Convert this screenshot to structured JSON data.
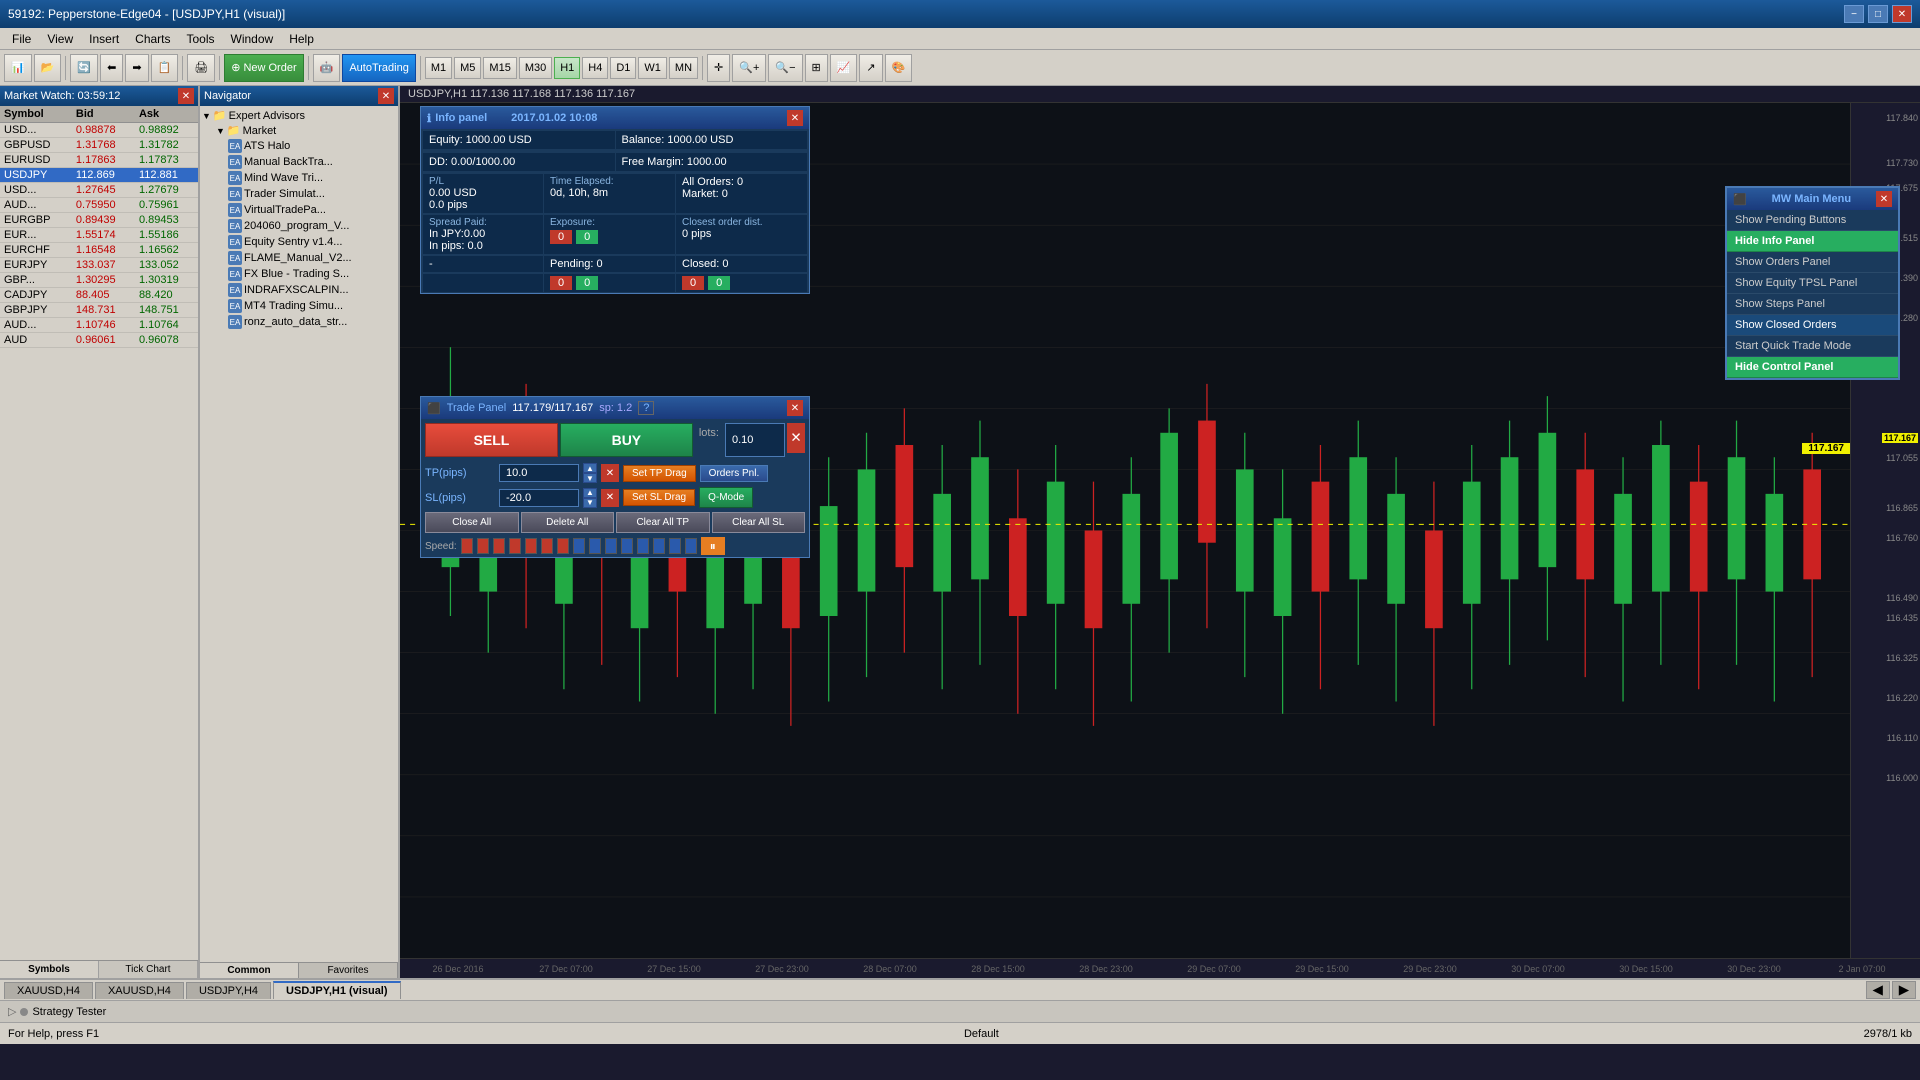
{
  "titleBar": {
    "title": "59192: Pepperstone-Edge04 - [USDJPY,H1 (visual)]",
    "minimizeLabel": "−",
    "maximizeLabel": "□",
    "closeLabel": "✕"
  },
  "menuBar": {
    "items": [
      "File",
      "View",
      "Insert",
      "Charts",
      "Tools",
      "Window",
      "Help"
    ]
  },
  "toolbar": {
    "newOrderLabel": "New Order",
    "autoTradingLabel": "AutoTrading",
    "periods": [
      "M1",
      "M5",
      "M15",
      "M30",
      "H1",
      "H4",
      "D1",
      "W1",
      "MN"
    ]
  },
  "chartHeader": {
    "title": "USDJPY,H1  117.136 117.168 117.136 117.167"
  },
  "marketWatch": {
    "header": "Market Watch: 03:59:12",
    "columns": [
      "Symbol",
      "Bid",
      "Ask"
    ],
    "rows": [
      {
        "symbol": "USD...",
        "bid": "0.98878",
        "ask": "0.98892",
        "selected": false
      },
      {
        "symbol": "GBPUSD",
        "bid": "1.31768",
        "ask": "1.31782",
        "selected": false
      },
      {
        "symbol": "EURUSD",
        "bid": "1.17863",
        "ask": "1.17873",
        "selected": false
      },
      {
        "symbol": "USDJPY",
        "bid": "112.869",
        "ask": "112.881",
        "selected": true
      },
      {
        "symbol": "USD...",
        "bid": "1.27645",
        "ask": "1.27679",
        "selected": false
      },
      {
        "symbol": "AUD...",
        "bid": "0.75950",
        "ask": "0.75961",
        "selected": false
      },
      {
        "symbol": "EURGBP",
        "bid": "0.89439",
        "ask": "0.89453",
        "selected": false
      },
      {
        "symbol": "EUR...",
        "bid": "1.55174",
        "ask": "1.55186",
        "selected": false
      },
      {
        "symbol": "EURCHF",
        "bid": "1.16548",
        "ask": "1.16562",
        "selected": false
      },
      {
        "symbol": "EURJPY",
        "bid": "133.037",
        "ask": "133.052",
        "selected": false
      },
      {
        "symbol": "GBP...",
        "bid": "1.30295",
        "ask": "1.30319",
        "selected": false
      },
      {
        "symbol": "CADJPY",
        "bid": "88.405",
        "ask": "88.420",
        "selected": false
      },
      {
        "symbol": "GBPJPY",
        "bid": "148.731",
        "ask": "148.751",
        "selected": false
      },
      {
        "symbol": "AUD...",
        "bid": "1.10746",
        "ask": "1.10764",
        "selected": false
      },
      {
        "symbol": "AUD",
        "bid": "0.96061",
        "ask": "0.96078",
        "selected": false
      }
    ],
    "tabs": [
      "Symbols",
      "Tick Chart"
    ]
  },
  "navigator": {
    "header": "Navigator",
    "expertAdvisors": {
      "label": "Expert Advisors",
      "market": {
        "label": "Market",
        "items": [
          "ATS Halo",
          "Manual BackTra...",
          "Mind Wave Tri...",
          "Trader Simulat...",
          "VirtualTradePa...",
          "204060_program_V...",
          "Equity Sentry v1.4...",
          "FLAME_Manual_V2...",
          "FX Blue - Trading S...",
          "INDRAFXSCALPIN...",
          "MT4 Trading Simu...",
          "ronz_auto_data_str..."
        ]
      }
    },
    "tabs": [
      "Common",
      "Favorites"
    ]
  },
  "infoPanel": {
    "title": "Info panel",
    "timestamp": "2017.01.02 10:08",
    "equity": "Equity: 1000.00 USD",
    "balance": "Balance: 1000.00 USD",
    "dd": "DD: 0.00/1000.00",
    "freeMargin": "Free Margin: 1000.00",
    "pl": "P/L",
    "timeElapsed": "Time Elapsed:",
    "plValue": "0.00 USD",
    "timeValue": "0d, 10h, 8m",
    "plPips": "0.0 pips",
    "exposure": "Exposure:",
    "exposureDash": "-",
    "allOrders": "All Orders: 0",
    "market": "Market: 0",
    "spreadPaid": "Spread Paid:",
    "inJPY": "In JPY:0.00",
    "inPips": "In pips: 0.0",
    "closestOrderDist": "Closest order dist.",
    "closestValue": "0 pips",
    "pending": "Pending: 0",
    "closed": "Closed: 0",
    "redVal1": "0",
    "greenVal1": "0",
    "redVal2": "0",
    "greenVal2": "0",
    "redVal3": "0",
    "greenVal3": "0"
  },
  "tradePanel": {
    "title": "Trade Panel",
    "price": "117.179/117.167",
    "spread": "sp: 1.2",
    "sellLabel": "SELL",
    "buyLabel": "BUY",
    "lotsLabel": "lots:",
    "lotsValue": "0.10",
    "tpLabel": "TP(pips)",
    "tpValue": "10.0",
    "setTpDrag": "Set TP Drag",
    "ordersPnl": "Orders Pnl.",
    "slLabel": "SL(pips)",
    "slValue": "-20.0",
    "setSlDrag": "Set SL Drag",
    "qMode": "Q-Mode",
    "closeAll": "Close All",
    "deleteAll": "Delete All",
    "clearAllTP": "Clear All TP",
    "clearAllSL": "Clear All SL",
    "speedLabel": "Speed:"
  },
  "mwMainMenu": {
    "title": "MW Main Menu",
    "items": [
      {
        "label": "Show Pending Buttons",
        "style": "normal"
      },
      {
        "label": "Hide Info Panel",
        "style": "green"
      },
      {
        "label": "Show Orders Panel",
        "style": "normal"
      },
      {
        "label": "Show Equity TPSL Panel",
        "style": "normal"
      },
      {
        "label": "Show Steps Panel",
        "style": "normal"
      },
      {
        "label": "Show Closed Orders",
        "style": "hover"
      },
      {
        "label": "Start Quick Trade Mode",
        "style": "normal"
      },
      {
        "label": "Hide Control Panel",
        "style": "green"
      }
    ]
  },
  "chartTabs": {
    "tabs": [
      "XAUUSD,H4",
      "XAUUSD,H4",
      "USDJPY,H4",
      "USDJPY,H1 (visual)"
    ],
    "activeIndex": 3
  },
  "priceAxis": {
    "prices": [
      "117.840",
      "117.730",
      "117.675",
      "117.515",
      "117.390",
      "117.280",
      "117.167",
      "117.055",
      "116.865",
      "116.760",
      "116.490",
      "116.435",
      "116.325",
      "116.220",
      "116.110",
      "116.000"
    ],
    "currentPrice": "117.167"
  },
  "timeAxis": {
    "labels": [
      "26 Dec 2016",
      "27 Dec 07:00",
      "27 Dec 15:00",
      "27 Dec 23:00",
      "28 Dec 07:00",
      "28 Dec 15:00",
      "28 Dec 23:00",
      "29 Dec 07:00",
      "29 Dec 15:00",
      "29 Dec 23:00",
      "30 Dec 07:00",
      "30 Dec 15:00",
      "30 Dec 23:00",
      "2 Jan 07:00"
    ]
  },
  "strategyTester": {
    "label": "Strategy Tester"
  },
  "statusBar": {
    "helpText": "For Help, press F1",
    "profile": "Default",
    "memory": "2978/1 kb"
  }
}
